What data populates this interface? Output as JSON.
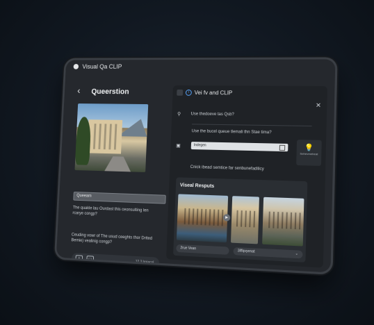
{
  "app": {
    "title": "Visual Qa CLIP"
  },
  "left": {
    "title": "Queerstion",
    "query_label": "Queeam",
    "query_text": "The quakle lau Ourdast this ceonsulting len rcarye congp?",
    "answer_text": "Ceuding vowr of The usud ceeghts thor Drited Bemie) vealinig congp?",
    "footer_meta": "12 3 Irojacol"
  },
  "right": {
    "header_title": "Vei fv and CLIP",
    "row1_text": "Use thedoeve tas Qsb?",
    "row2_text": "Use the bucel queue tlemali thn Stae tima?",
    "field_value": "Indegen",
    "row3_text": "Cnick ibead semtice far senbunefadilicy",
    "bulb_label": "Sehevmeheat",
    "results_title": "Viseal Resputs",
    "chip1": "2rue Vean",
    "chip2": "3iffqvyenat"
  },
  "colors": {
    "accent": "#58a6ff",
    "panel": "#25282d"
  },
  "icons": [
    "back-icon",
    "search-icon",
    "close-icon",
    "bulb-icon",
    "play-icon",
    "chevron-down-icon"
  ]
}
